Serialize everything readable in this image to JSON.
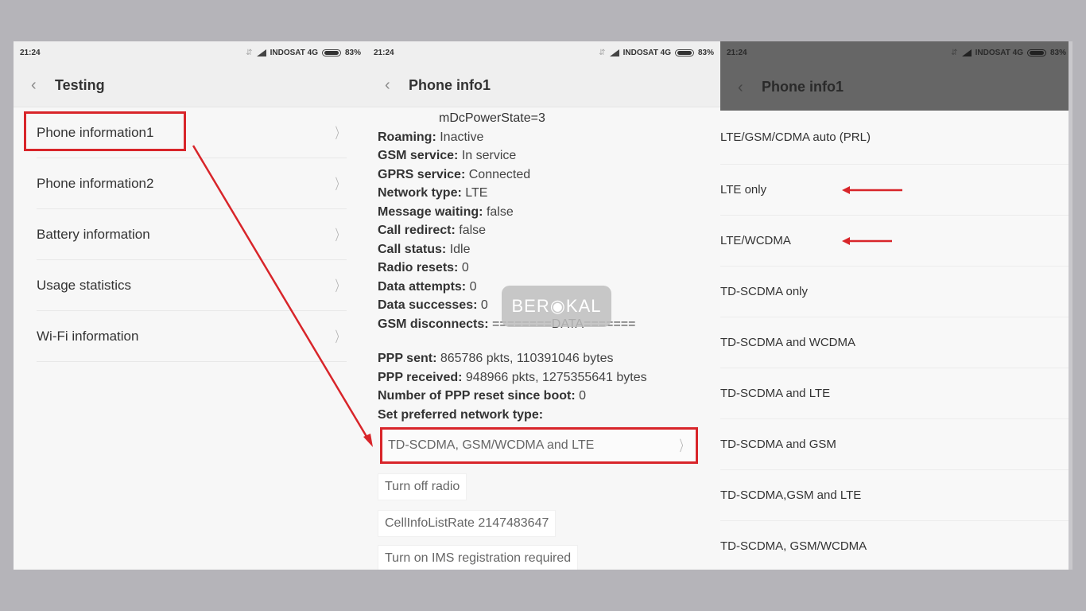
{
  "status_bar": {
    "time": "21:24",
    "carrier": "INDOSAT 4G",
    "battery_percent": "83%",
    "battery_level": 0.83
  },
  "panel1": {
    "title": "Testing",
    "items": [
      {
        "label": "Phone information1",
        "highlighted": true
      },
      {
        "label": "Phone information2"
      },
      {
        "label": "Battery information"
      },
      {
        "label": "Usage statistics"
      },
      {
        "label": "Wi-Fi information"
      }
    ]
  },
  "panel2": {
    "title": "Phone info1",
    "top_line": "mDcPowerState=3",
    "rows": [
      {
        "key": "Roaming:",
        "value": "Inactive"
      },
      {
        "key": "GSM service:",
        "value": "In service"
      },
      {
        "key": "GPRS service:",
        "value": "Connected"
      },
      {
        "key": "Network type:",
        "value": "LTE"
      },
      {
        "key": "Message waiting:",
        "value": "false"
      },
      {
        "key": "Call redirect:",
        "value": "false"
      },
      {
        "key": "Call status:",
        "value": "Idle"
      },
      {
        "key": "Radio resets:",
        "value": "0"
      },
      {
        "key": "Data attempts:",
        "value": "0"
      },
      {
        "key": "Data successes:",
        "value": "0"
      },
      {
        "key": "GSM disconnects:",
        "value": "========DATA======="
      }
    ],
    "rows2": [
      {
        "key": "PPP sent:",
        "value": "865786 pkts, 110391046 bytes"
      },
      {
        "key": "PPP received:",
        "value": "948966 pkts, 1275355641 bytes"
      },
      {
        "key": "Number of PPP reset since boot:",
        "value": "0"
      },
      {
        "key": "Set preferred network type:",
        "value": ""
      }
    ],
    "preferred_network_value": "TD-SCDMA, GSM/WCDMA and LTE",
    "buttons": [
      "Turn off radio",
      "CellInfoListRate 2147483647",
      "Turn on IMS registration required"
    ],
    "watermark": "BER◉KAL"
  },
  "panel3": {
    "title": "Phone info1",
    "options": [
      {
        "label": "LTE/GSM/CDMA auto (PRL)"
      },
      {
        "label": "LTE only",
        "marked": true
      },
      {
        "label": "LTE/WCDMA",
        "marked": true
      },
      {
        "label": "TD-SCDMA only"
      },
      {
        "label": "TD-SCDMA and WCDMA"
      },
      {
        "label": "TD-SCDMA and LTE"
      },
      {
        "label": "TD-SCDMA and GSM"
      },
      {
        "label": "TD-SCDMA,GSM and LTE"
      },
      {
        "label": "TD-SCDMA, GSM/WCDMA"
      }
    ]
  },
  "colors": {
    "annotation_red": "#d8252a",
    "background": "#b5b4b9",
    "dim_header": "#666666"
  }
}
